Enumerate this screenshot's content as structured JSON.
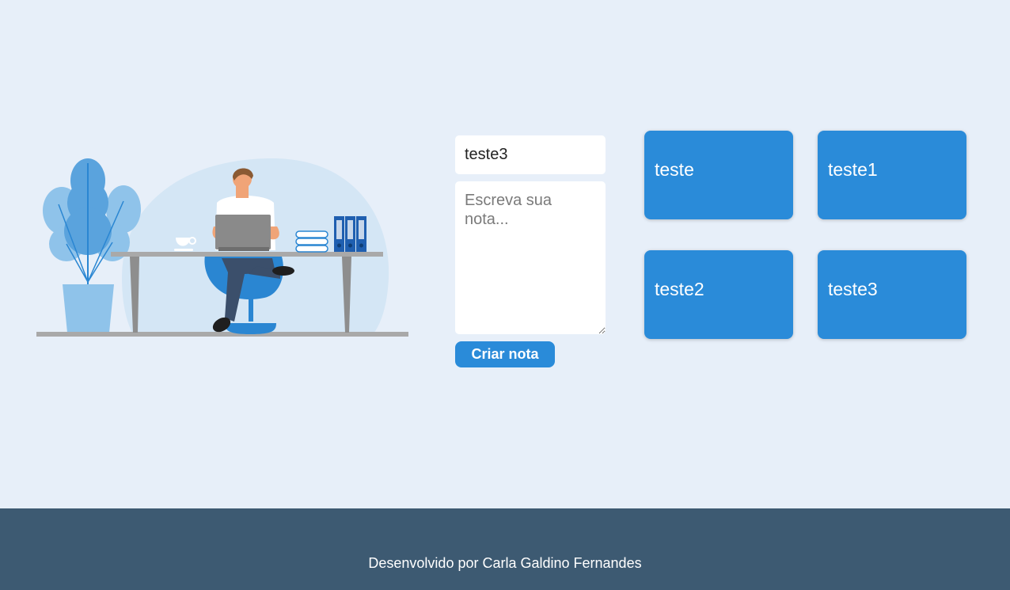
{
  "colors": {
    "page_background": "#e7eff9",
    "accent": "#2a8bd9",
    "footer_background": "#3d5a72"
  },
  "form": {
    "title_value": "teste3",
    "body_placeholder": "Escreva sua nota...",
    "body_value": "",
    "create_label": "Criar nota"
  },
  "notes": [
    {
      "title": "teste"
    },
    {
      "title": "teste1"
    },
    {
      "title": "teste2"
    },
    {
      "title": "teste3"
    }
  ],
  "footer": {
    "credit": "Desenvolvido por Carla Galdino Fernandes"
  }
}
